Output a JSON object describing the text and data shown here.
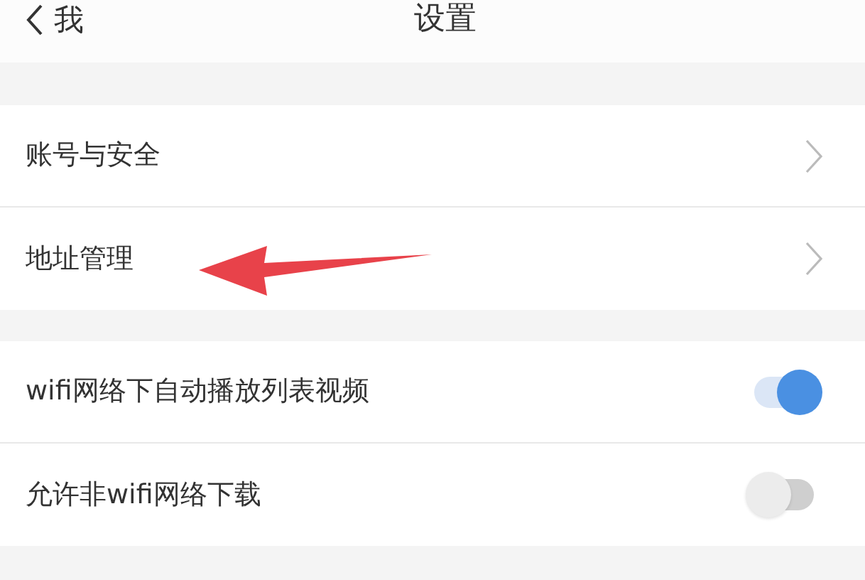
{
  "header": {
    "back": "我",
    "title": "设置"
  },
  "groups": [
    {
      "items": [
        {
          "kind": "link",
          "label": "账号与安全"
        },
        {
          "kind": "link",
          "label": "地址管理"
        }
      ]
    },
    {
      "items": [
        {
          "kind": "toggle",
          "label": "wifi网络下自动播放列表视频",
          "on": true
        },
        {
          "kind": "toggle",
          "label": "允许非wifi网络下载",
          "on": false
        }
      ]
    }
  ]
}
